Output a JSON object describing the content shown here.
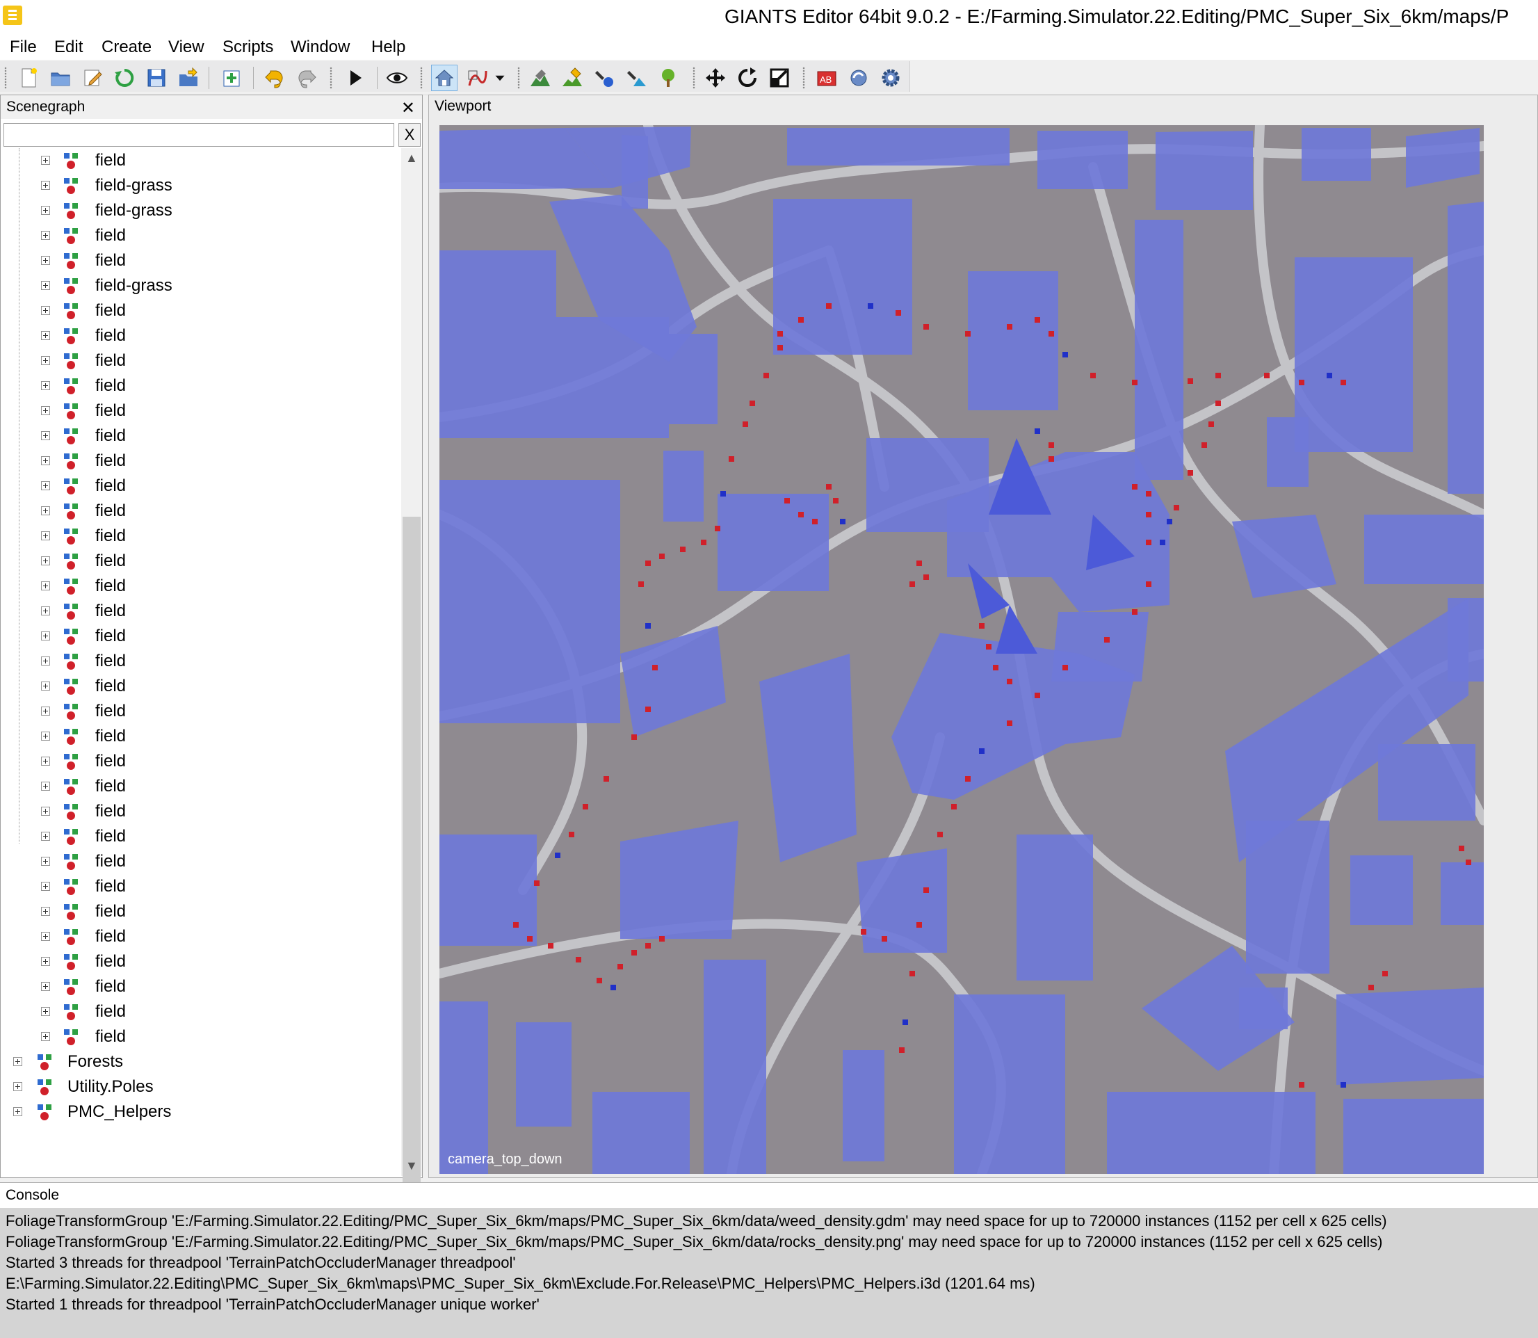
{
  "window": {
    "title": "GIANTS Editor 64bit 9.0.2 - E:/Farming.Simulator.22.Editing/PMC_Super_Six_6km/maps/P"
  },
  "menu": [
    "File",
    "Edit",
    "Create",
    "View",
    "Scripts",
    "Window",
    "Help"
  ],
  "toolbar": {
    "buttons": [
      "new-file-icon",
      "open-folder-icon",
      "edit-icon",
      "reload-icon",
      "save-icon",
      "export-icon",
      "import-icon",
      "undo-icon",
      "redo-icon",
      "play-icon",
      "eye-icon",
      "camera-home-icon",
      "spline-icon",
      "dropdown-icon",
      "terrain-sculpt-icon",
      "terrain-paint-icon",
      "foliage-paint-icon",
      "decal-paint-icon",
      "tree-paint-icon",
      "move-icon",
      "rotate-icon",
      "scale-icon",
      "bake-icon",
      "refresh-shader-icon",
      "settings-gear-icon"
    ]
  },
  "scenegraph": {
    "title": "Scenegraph",
    "close_label": "✕",
    "search_value": "",
    "clear_label": "X",
    "items": [
      "field",
      "field-grass",
      "field-grass",
      "field",
      "field",
      "field-grass",
      "field",
      "field",
      "field",
      "field",
      "field",
      "field",
      "field",
      "field",
      "field",
      "field",
      "field",
      "field",
      "field",
      "field",
      "field",
      "field",
      "field",
      "field",
      "field",
      "field",
      "field",
      "field",
      "field",
      "field",
      "field",
      "field",
      "field",
      "field",
      "field",
      "field"
    ],
    "root_items": [
      "Forests",
      "Utility.Poles",
      "PMC_Helpers"
    ]
  },
  "viewport": {
    "title": "Viewport",
    "camera_label": "camera_top_down"
  },
  "console": {
    "title": "Console",
    "lines": [
      "FoliageTransformGroup 'E:/Farming.Simulator.22.Editing/PMC_Super_Six_6km/maps/PMC_Super_Six_6km/data/weed_density.gdm' may need space for up to 720000 instances (1152 per cell x 625 cells)",
      "FoliageTransformGroup 'E:/Farming.Simulator.22.Editing/PMC_Super_Six_6km/maps/PMC_Super_Six_6km/data/rocks_density.png' may need space for up to 720000 instances (1152 per cell x 625 cells)",
      "Started 3 threads for threadpool 'TerrainPatchOccluderManager threadpool'",
      "E:\\Farming.Simulator.22.Editing\\PMC_Super_Six_6km\\maps\\PMC_Super_Six_6km\\Exclude.For.Release\\PMC_Helpers\\PMC_Helpers.i3d (1201.64 ms)",
      "Started 1 threads for threadpool 'TerrainPatchOccluderManager unique worker'"
    ]
  },
  "colors": {
    "field_fill": "#6f78d8",
    "terrain": "#8f8a90",
    "road": "#c4c4c8",
    "marker_red": "#d0202a",
    "marker_blue": "#2030c8"
  }
}
